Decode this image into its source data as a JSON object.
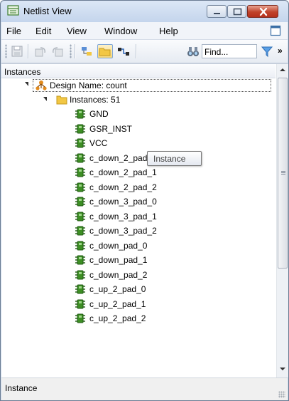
{
  "window": {
    "title": "Netlist View"
  },
  "menu": [
    "File",
    "Edit",
    "View",
    "Window",
    "Help"
  ],
  "toolbar": {
    "find_placeholder": "Find...",
    "overflow": "»"
  },
  "panel": {
    "header": "Instances",
    "tooltip": "Instance"
  },
  "tree": {
    "design_label": "Design Name: count",
    "instances_label": "Instances: 51",
    "items": [
      "GND",
      "GSR_INST",
      "VCC",
      "c_down_2_pad_0",
      "c_down_2_pad_1",
      "c_down_2_pad_2",
      "c_down_3_pad_0",
      "c_down_3_pad_1",
      "c_down_3_pad_2",
      "c_down_pad_0",
      "c_down_pad_1",
      "c_down_pad_2",
      "c_up_2_pad_0",
      "c_up_2_pad_1",
      "c_up_2_pad_2"
    ]
  },
  "statusbar": {
    "text": "Instance"
  },
  "colors": {
    "accent": "#3a6ea5",
    "chip_green": "#2e7d1f",
    "folder_yellow": "#f2c744",
    "close_red": "#c0432a"
  }
}
